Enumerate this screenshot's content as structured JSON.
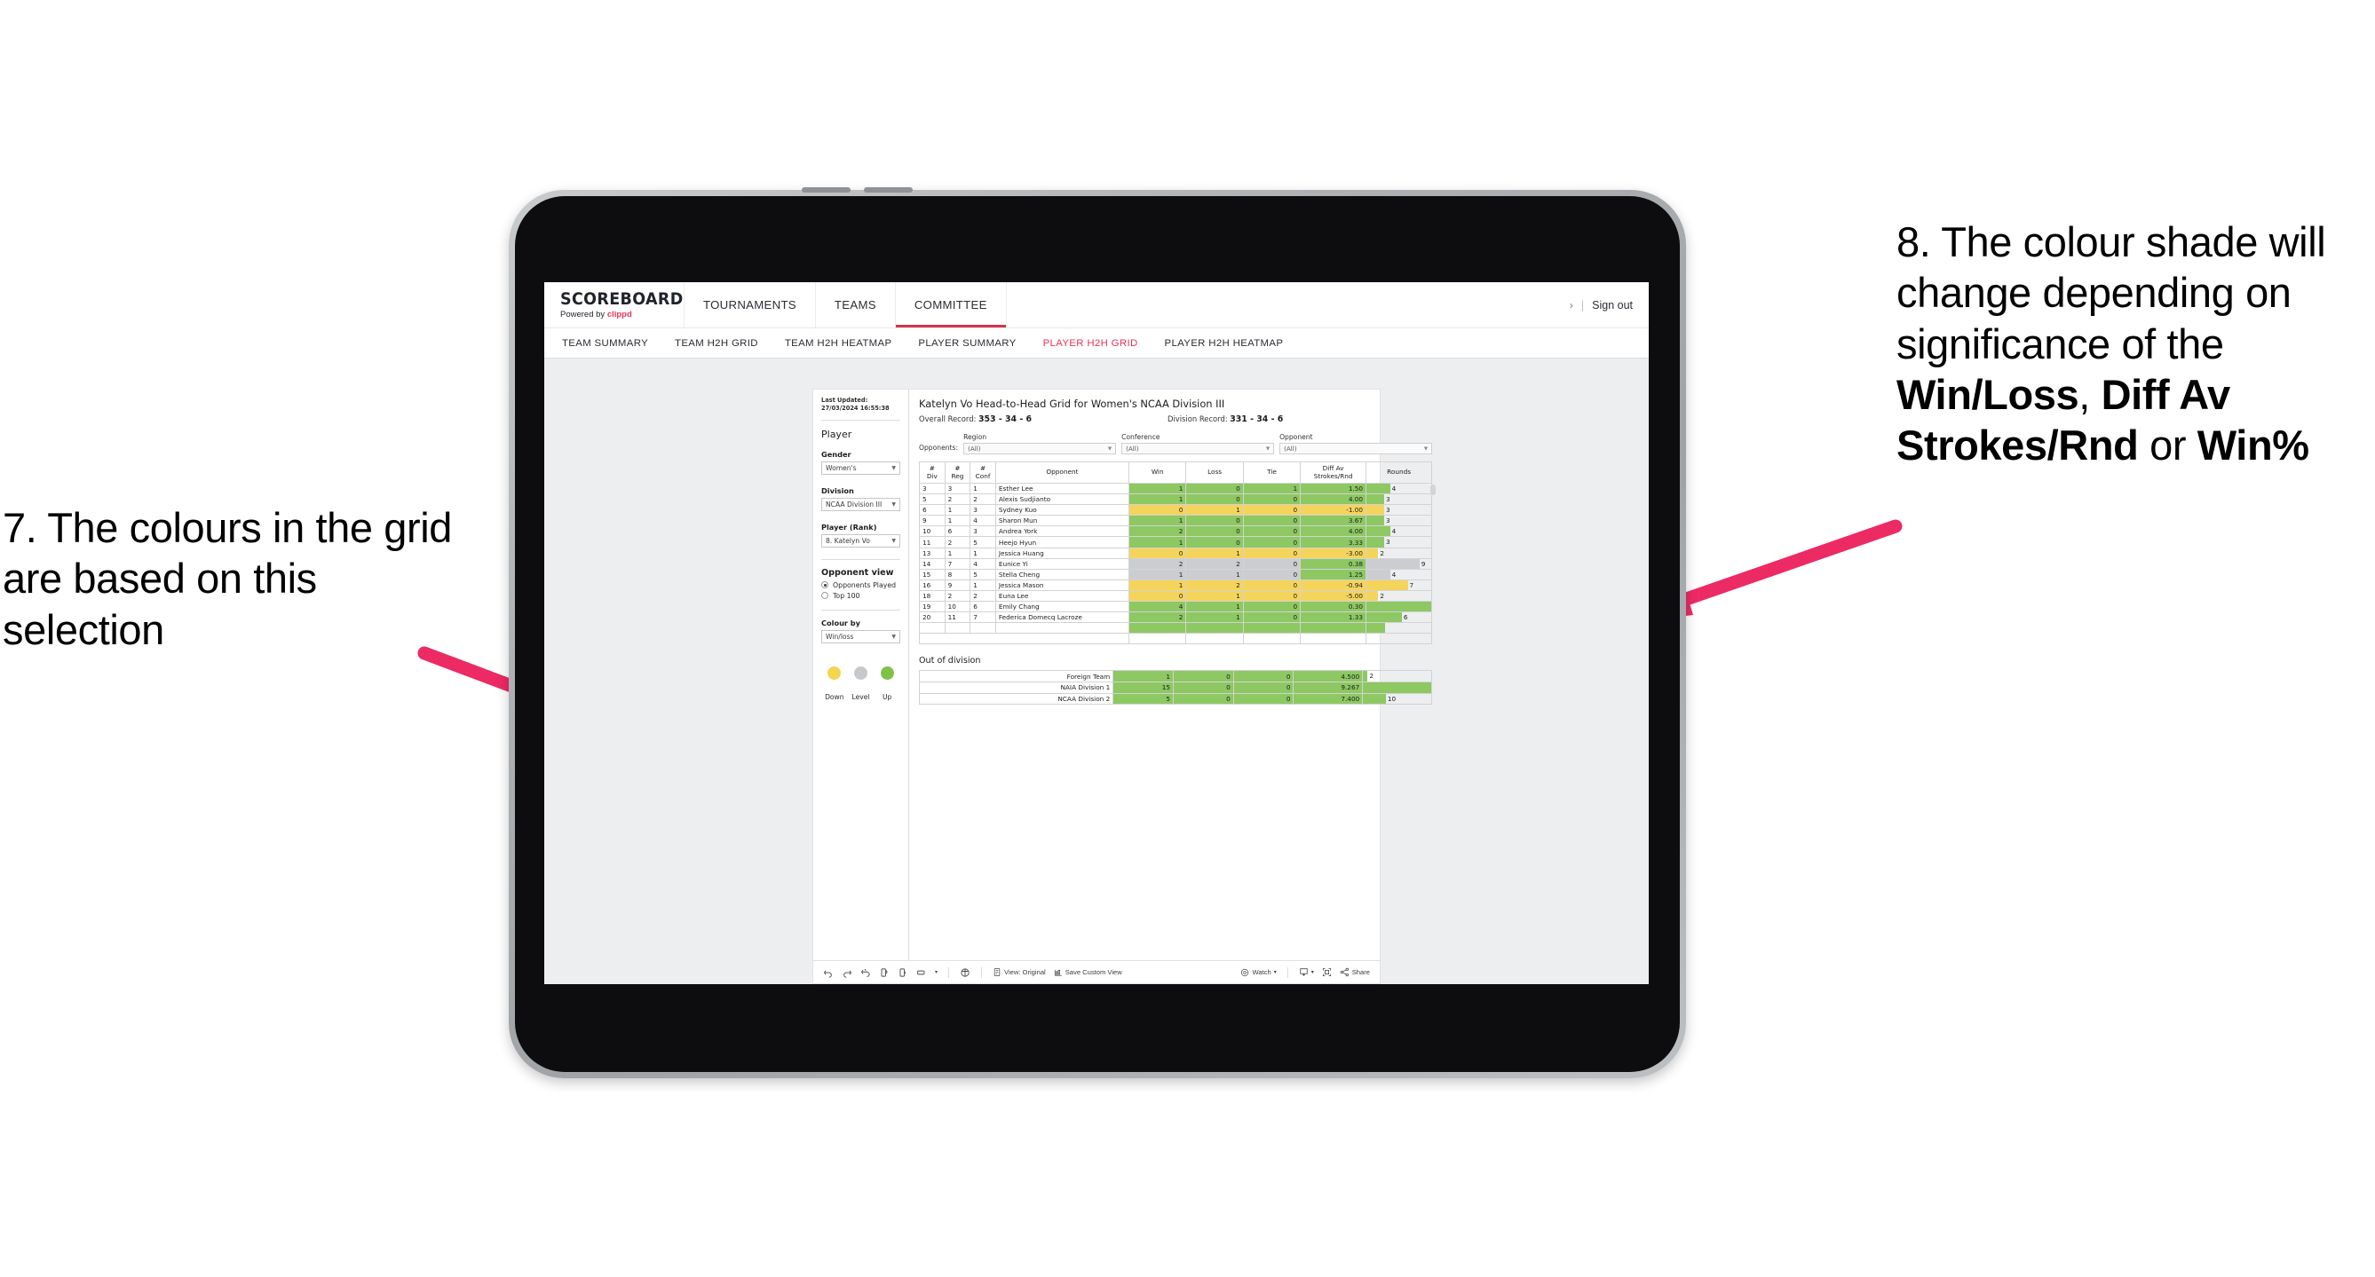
{
  "annotations": {
    "left": "7. The colours in the grid are based on this selection",
    "right_prefix": "8. The colour shade will change depending on significance of the ",
    "right_bold1": "Win/Loss",
    "right_mid1": ", ",
    "right_bold2": "Diff Av Strokes/Rnd",
    "right_mid2": " or ",
    "right_bold3": "Win%",
    "arrow_color": "#EC2A64"
  },
  "header": {
    "brand_name": "SCOREBOARD",
    "brand_sub_prefix": "Powered by ",
    "brand_sub_accent": "clippd",
    "nav": [
      {
        "label": "TOURNAMENTS",
        "active": false
      },
      {
        "label": "TEAMS",
        "active": false
      },
      {
        "label": "COMMITTEE",
        "active": true
      }
    ],
    "chevron": "›",
    "pipe": "|",
    "sign_out": "Sign out"
  },
  "subnav": [
    {
      "label": "TEAM SUMMARY",
      "active": false
    },
    {
      "label": "TEAM H2H GRID",
      "active": false
    },
    {
      "label": "TEAM H2H HEATMAP",
      "active": false
    },
    {
      "label": "PLAYER SUMMARY",
      "active": false
    },
    {
      "label": "PLAYER H2H GRID",
      "active": true
    },
    {
      "label": "PLAYER H2H HEATMAP",
      "active": false
    }
  ],
  "sidebar": {
    "last_updated": "Last Updated: 27/03/2024 16:55:38",
    "section_player": "Player",
    "gender_label": "Gender",
    "gender_value": "Women's",
    "division_label": "Division",
    "division_value": "NCAA Division III",
    "player_label": "Player (Rank)",
    "player_value": "8. Katelyn Vo",
    "opponent_view_label": "Opponent view",
    "opponent_options": [
      {
        "label": "Opponents Played",
        "selected": true
      },
      {
        "label": "Top 100",
        "selected": false
      }
    ],
    "colour_by_label": "Colour by",
    "colour_by_value": "Win/loss",
    "legend": [
      {
        "label": "Down",
        "color": "#F5D450"
      },
      {
        "label": "Level",
        "color": "#C6C9CC"
      },
      {
        "label": "Up",
        "color": "#7EC24A"
      }
    ]
  },
  "main": {
    "title": "Katelyn Vo Head-to-Head Grid for Women's NCAA Division III",
    "overall_record_label": "Overall Record: ",
    "overall_record_value": "353 -  34 - 6",
    "division_record_label": "Division Record: ",
    "division_record_value": "331 -  34 - 6",
    "opponents_label": "Opponents:",
    "filters": [
      {
        "label": "Region",
        "value": "(All)"
      },
      {
        "label": "Conference",
        "value": "(All)"
      },
      {
        "label": "Opponent",
        "value": "(All)"
      }
    ],
    "out_of_division_title": "Out of division"
  },
  "chart_data": {
    "type": "table",
    "title": "Katelyn Vo Head-to-Head Grid for Women's NCAA Division III",
    "columns": [
      "# Div",
      "# Reg",
      "# Conf",
      "Opponent",
      "Win",
      "Loss",
      "Tie",
      "Diff Av Strokes/Rnd",
      "Rounds"
    ],
    "column_header_lines": [
      [
        "#",
        "Div"
      ],
      [
        "#",
        "Reg"
      ],
      [
        "#",
        "Conf"
      ],
      [
        "Opponent"
      ],
      [
        "Win"
      ],
      [
        "Loss"
      ],
      [
        "Tie"
      ],
      [
        "Diff Av",
        "Strokes/Rnd"
      ],
      [
        "Rounds"
      ]
    ],
    "rounds_max": 11,
    "rows": [
      {
        "div": "3",
        "reg": "3",
        "conf": "1",
        "opponent": "Esther Lee",
        "win": "1",
        "loss": "0",
        "tie": "1",
        "diff": "1.50",
        "rounds": "4",
        "color": "#8DC863",
        "diff_color": "#8DC863"
      },
      {
        "div": "5",
        "reg": "2",
        "conf": "2",
        "opponent": "Alexis Sudjianto",
        "win": "1",
        "loss": "0",
        "tie": "0",
        "diff": "4.00",
        "rounds": "3",
        "color": "#8DC863",
        "diff_color": "#8DC863"
      },
      {
        "div": "6",
        "reg": "1",
        "conf": "3",
        "opponent": "Sydney Kuo",
        "win": "0",
        "loss": "1",
        "tie": "0",
        "diff": "-1.00",
        "rounds": "3",
        "color": "#F5D45C",
        "diff_color": "#F5D45C"
      },
      {
        "div": "9",
        "reg": "1",
        "conf": "4",
        "opponent": "Sharon Mun",
        "win": "1",
        "loss": "0",
        "tie": "0",
        "diff": "3.67",
        "rounds": "3",
        "color": "#8DC863",
        "diff_color": "#8DC863"
      },
      {
        "div": "10",
        "reg": "6",
        "conf": "3",
        "opponent": "Andrea York",
        "win": "2",
        "loss": "0",
        "tie": "0",
        "diff": "4.00",
        "rounds": "4",
        "color": "#8DC863",
        "diff_color": "#8DC863"
      },
      {
        "div": "11",
        "reg": "2",
        "conf": "5",
        "opponent": "Heejo Hyun",
        "win": "1",
        "loss": "0",
        "tie": "0",
        "diff": "3.33",
        "rounds": "3",
        "color": "#8DC863",
        "diff_color": "#8DC863"
      },
      {
        "div": "13",
        "reg": "1",
        "conf": "1",
        "opponent": "Jessica Huang",
        "win": "0",
        "loss": "1",
        "tie": "0",
        "diff": "-3.00",
        "rounds": "2",
        "color": "#F5D45C",
        "diff_color": "#F5D45C"
      },
      {
        "div": "14",
        "reg": "7",
        "conf": "4",
        "opponent": "Eunice Yi",
        "win": "2",
        "loss": "2",
        "tie": "0",
        "diff": "0.38",
        "rounds": "9",
        "color": "#CBCDD0",
        "diff_color": "#8DC863"
      },
      {
        "div": "15",
        "reg": "8",
        "conf": "5",
        "opponent": "Stella Cheng",
        "win": "1",
        "loss": "1",
        "tie": "0",
        "diff": "1.25",
        "rounds": "4",
        "color": "#CBCDD0",
        "diff_color": "#8DC863"
      },
      {
        "div": "16",
        "reg": "9",
        "conf": "1",
        "opponent": "Jessica Mason",
        "win": "1",
        "loss": "2",
        "tie": "0",
        "diff": "-0.94",
        "rounds": "7",
        "color": "#F5D45C",
        "diff_color": "#F5D45C"
      },
      {
        "div": "18",
        "reg": "2",
        "conf": "2",
        "opponent": "Euna Lee",
        "win": "0",
        "loss": "1",
        "tie": "0",
        "diff": "-5.00",
        "rounds": "2",
        "color": "#F5D45C",
        "diff_color": "#F5D45C"
      },
      {
        "div": "19",
        "reg": "10",
        "conf": "6",
        "opponent": "Emily Chang",
        "win": "4",
        "loss": "1",
        "tie": "0",
        "diff": "0.30",
        "rounds": "11",
        "color": "#8DC863",
        "diff_color": "#8DC863"
      },
      {
        "div": "20",
        "reg": "11",
        "conf": "7",
        "opponent": "Federica Domecq Lacroze",
        "win": "2",
        "loss": "1",
        "tie": "0",
        "diff": "1.33",
        "rounds": "6",
        "color": "#8DC863",
        "diff_color": "#8DC863"
      }
    ],
    "out_of_division": {
      "rounds_max": 30,
      "rows": [
        {
          "name": "Foreign Team",
          "win": "1",
          "loss": "0",
          "tie": "0",
          "diff": "4.500",
          "rounds": "2",
          "color": "#8DC863"
        },
        {
          "name": "NAIA Division 1",
          "win": "15",
          "loss": "0",
          "tie": "0",
          "diff": "9.267",
          "rounds": "30",
          "color": "#8DC863"
        },
        {
          "name": "NCAA Division 2",
          "win": "5",
          "loss": "0",
          "tie": "0",
          "diff": "7.400",
          "rounds": "10",
          "color": "#8DC863"
        }
      ]
    }
  },
  "toolbar": {
    "view_label": "View: Original",
    "save_label": "Save Custom View",
    "watch_label": "Watch",
    "share_label": "Share",
    "caret": "▾"
  }
}
